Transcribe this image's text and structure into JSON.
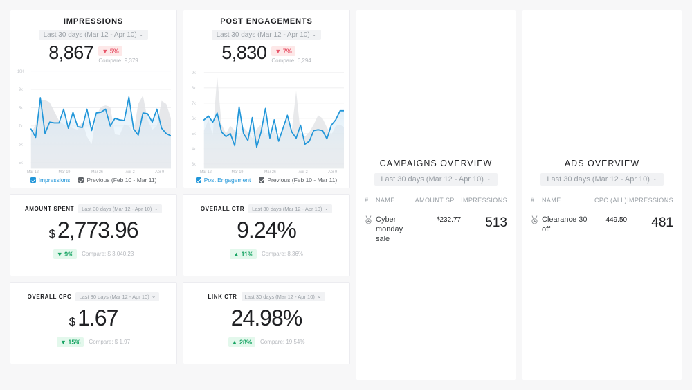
{
  "theme": {
    "accent_blue": "#2196d9",
    "prev_grey": "#5f6368",
    "down_red": "#e8576b",
    "up_green": "#17a463",
    "text_dark": "#202124",
    "muted": "#9aa0a6",
    "card_bg": "#ffffff",
    "page_bg": "#f7f7f8"
  },
  "impressions_card": {
    "title": "IMPRESSIONS",
    "date_range": "Last 30 days (Mar 12 - Apr 10)",
    "chevron": "⌄",
    "value": "8,867",
    "delta": "5%",
    "delta_arrow": "▼",
    "delta_direction": "down",
    "compare": "Compare: 9,379",
    "legend": [
      {
        "label": "Impressions",
        "color": "#2196d9",
        "checked": true
      },
      {
        "label": "Previous (Feb 10 - Mar 11)",
        "color": "#5f6368",
        "checked": true
      }
    ]
  },
  "engagements_card": {
    "title": "POST ENGAGEMENTS",
    "date_range": "Last 30 days (Mar 12 - Apr 10)",
    "chevron": "⌄",
    "value": "5,830",
    "delta": "7%",
    "delta_arrow": "▼",
    "delta_direction": "down",
    "compare": "Compare: 6,294",
    "legend": [
      {
        "label": "Post Engagement",
        "color": "#2196d9",
        "checked": true
      },
      {
        "label": "Previous (Feb 10 - Mar 11)",
        "color": "#5f6368",
        "checked": true
      }
    ]
  },
  "stats": [
    {
      "title": "AMOUNT SPENT",
      "date_range": "Last 30 days (Mar 12 - Apr 10)",
      "currency": "$",
      "value": "2,773.96",
      "delta": "9%",
      "delta_arrow": "▼",
      "delta_style": "downgreen",
      "compare": "Compare: $ 3,040.23"
    },
    {
      "title": "OVERALL CTR",
      "date_range": "Last 30 days (Mar 12 - Apr 10)",
      "currency": "",
      "value": "9.24%",
      "delta": "11%",
      "delta_arrow": "▲",
      "delta_style": "up",
      "compare": "Compare: 8.36%"
    },
    {
      "title": "OVERALL CPC",
      "date_range": "Last 30 days (Mar 12 - Apr 10)",
      "currency": "$",
      "value": "1.67",
      "delta": "15%",
      "delta_arrow": "▼",
      "delta_style": "downgreen",
      "compare": "Compare: $ 1.97"
    },
    {
      "title": "LINK CTR",
      "date_range": "Last 30 days (Mar 12 - Apr 10)",
      "currency": "",
      "value": "24.98%",
      "delta": "28%",
      "delta_arrow": "▲",
      "delta_style": "up",
      "compare": "Compare: 19.54%"
    }
  ],
  "campaigns_panel": {
    "title": "CAMPAIGNS OVERVIEW",
    "date_range": "Last 30 days (Mar 12 - Apr 10)",
    "chevron": "⌄",
    "columns": [
      "#",
      "NAME",
      "AMOUNT SP…",
      "IMPRESSIONS"
    ],
    "rows": [
      {
        "rank_icon": "medal-icon",
        "name": "Cyber monday sale",
        "currency": "$",
        "amount": "232.77",
        "impressions": "513"
      }
    ]
  },
  "ads_panel": {
    "title": "ADS OVERVIEW",
    "date_range": "Last 30 days (Mar 12 - Apr 10)",
    "chevron": "⌄",
    "columns": [
      "#",
      "NAME",
      "CPC (ALL)",
      "IMPRESSIONS"
    ],
    "rows": [
      {
        "rank_icon": "medal-icon",
        "name": "Clearance 30 off",
        "currency": "",
        "amount": "449.50",
        "impressions": "481"
      }
    ]
  },
  "chart_data": [
    {
      "type": "line",
      "title": "IMPRESSIONS",
      "xlabel": "",
      "ylabel": "",
      "ylim": [
        5000,
        10000
      ],
      "yticks": [
        "5k",
        "6k",
        "7k",
        "8k",
        "9k",
        "10K"
      ],
      "xticks": [
        "Mar 12",
        "Mar 19",
        "Mar 26",
        "Apr 2",
        "Apr 9"
      ],
      "grid": true,
      "legend_position": "bottom",
      "series": [
        {
          "name": "Impressions",
          "color": "#2196d9",
          "values": [
            6900,
            6450,
            9050,
            6600,
            7450,
            7430,
            7420,
            8350,
            6950,
            8120,
            7020,
            7000,
            8350,
            6800,
            8100,
            8150,
            8320,
            7100,
            7600,
            7530,
            7450,
            9100,
            6900,
            6500,
            8100,
            8050,
            7150,
            8350,
            7300,
            6800,
            6700
          ]
        },
        {
          "name": "Previous (Feb 10 - Mar 11)",
          "color": "#5f6368",
          "values": [
            6600,
            7100,
            8400,
            8450,
            8300,
            7800,
            7200,
            7000,
            6900,
            6750,
            6650,
            7200,
            6350,
            6000,
            7600,
            8150,
            8250,
            8150,
            6650,
            6600,
            7300,
            7200,
            6800,
            8650,
            9100,
            7500,
            6900,
            7200,
            8400,
            8200,
            7300
          ]
        }
      ]
    },
    {
      "type": "line",
      "title": "POST ENGAGEMENTS",
      "xlabel": "",
      "ylabel": "",
      "ylim": [
        3000,
        9000
      ],
      "yticks": [
        "3k",
        "4k",
        "5k",
        "6k",
        "7k",
        "8k",
        "9k"
      ],
      "xticks": [
        "Mar 12",
        "Mar 19",
        "Mar 26",
        "Apr 2",
        "Apr 9"
      ],
      "grid": true,
      "legend_position": "bottom",
      "series": [
        {
          "name": "Post Engagement",
          "color": "#2196d9",
          "values": [
            5900,
            6150,
            5750,
            6350,
            5100,
            4800,
            5000,
            4200,
            6750,
            5000,
            4550,
            6050,
            4100,
            5100,
            6650,
            4700,
            5900,
            4500,
            5350,
            6200,
            5100,
            4700,
            5550,
            4300,
            4500,
            5200,
            5250,
            5200,
            4650,
            5550,
            5800,
            6400
          ]
        },
        {
          "name": "Previous (Feb 10 - Mar 11)",
          "color": "#5f6368",
          "values": [
            5200,
            5900,
            4900,
            8700,
            5400,
            5000,
            5500,
            5200,
            4700,
            5400,
            5100,
            4700,
            5300,
            5600,
            4900,
            5000,
            5100,
            4600,
            5200,
            6000,
            5200,
            7800,
            5000,
            4800,
            5100,
            5500,
            6100,
            5900,
            5300,
            4900,
            5400,
            5500
          ]
        }
      ]
    }
  ]
}
